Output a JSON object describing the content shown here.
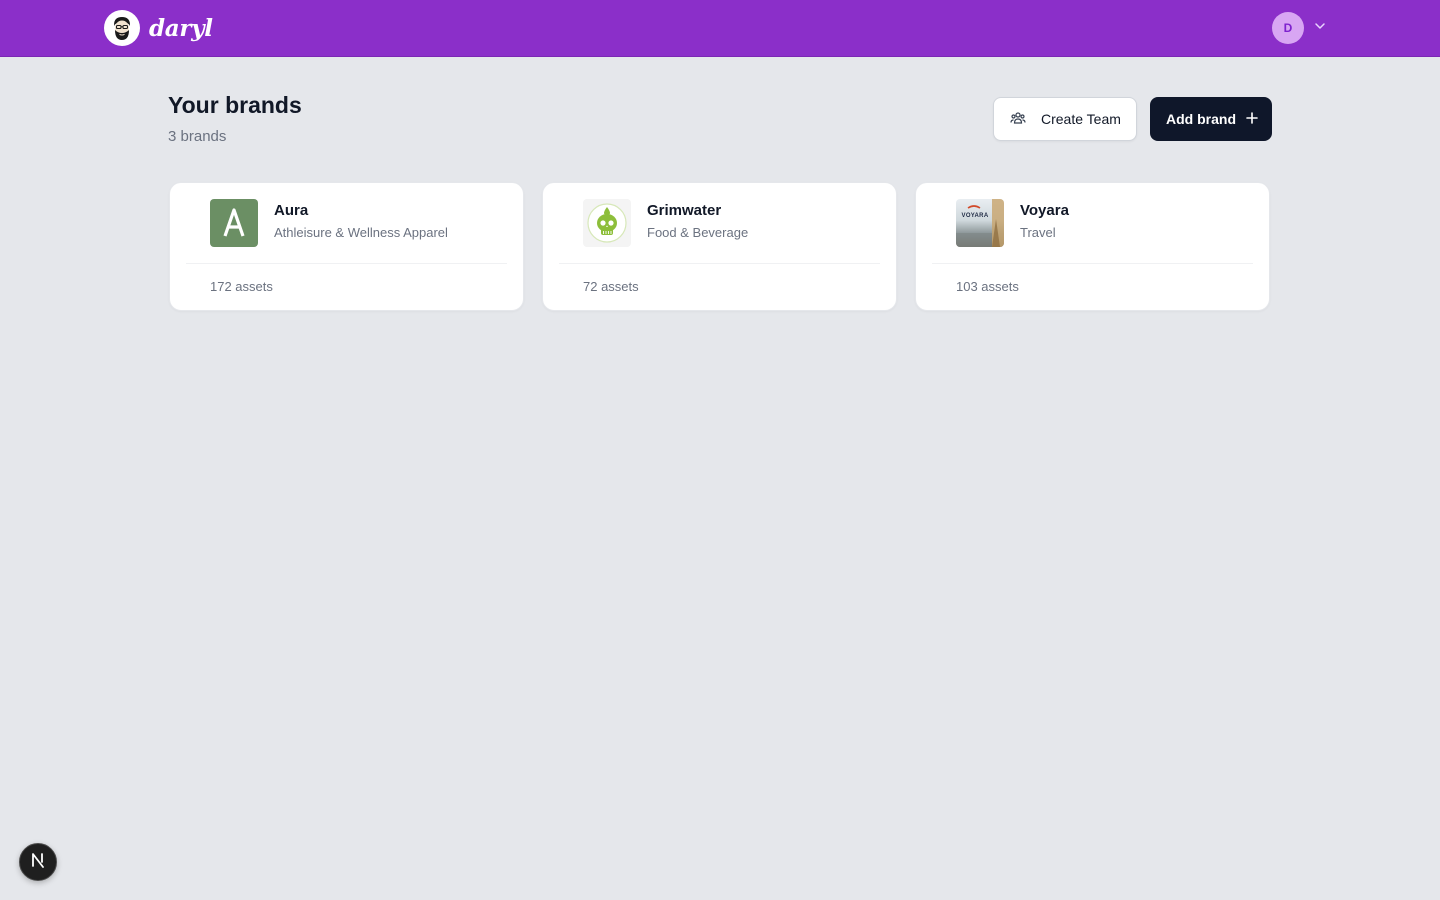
{
  "app": {
    "name": "daryl",
    "logo_icon": "bearded-face-icon"
  },
  "user": {
    "initial": "D",
    "avatar_bg": "#d8a6f3",
    "menu_icon": "chevron-down-icon"
  },
  "colors": {
    "topbar": "#8b2fc9",
    "primary_button": "#0f172a",
    "background": "#e5e7eb"
  },
  "page": {
    "title": "Your brands",
    "subtitle": "3 brands"
  },
  "actions": {
    "create_team_label": "Create Team",
    "create_team_icon": "team-icon",
    "add_brand_label": "Add brand",
    "add_brand_icon": "plus-icon"
  },
  "brands": [
    {
      "name": "Aura",
      "category": "Athleisure & Wellness Apparel",
      "assets": "172 assets",
      "logo": "letter-a-logo"
    },
    {
      "name": "Grimwater",
      "category": "Food & Beverage",
      "assets": "72 assets",
      "logo": "skull-logo"
    },
    {
      "name": "Voyara",
      "category": "Travel",
      "assets": "103 assets",
      "logo": "voyara-photo-logo",
      "logo_text": "VOYARA"
    }
  ],
  "dev_badge": {
    "label": "N",
    "icon": "nextjs-icon"
  }
}
